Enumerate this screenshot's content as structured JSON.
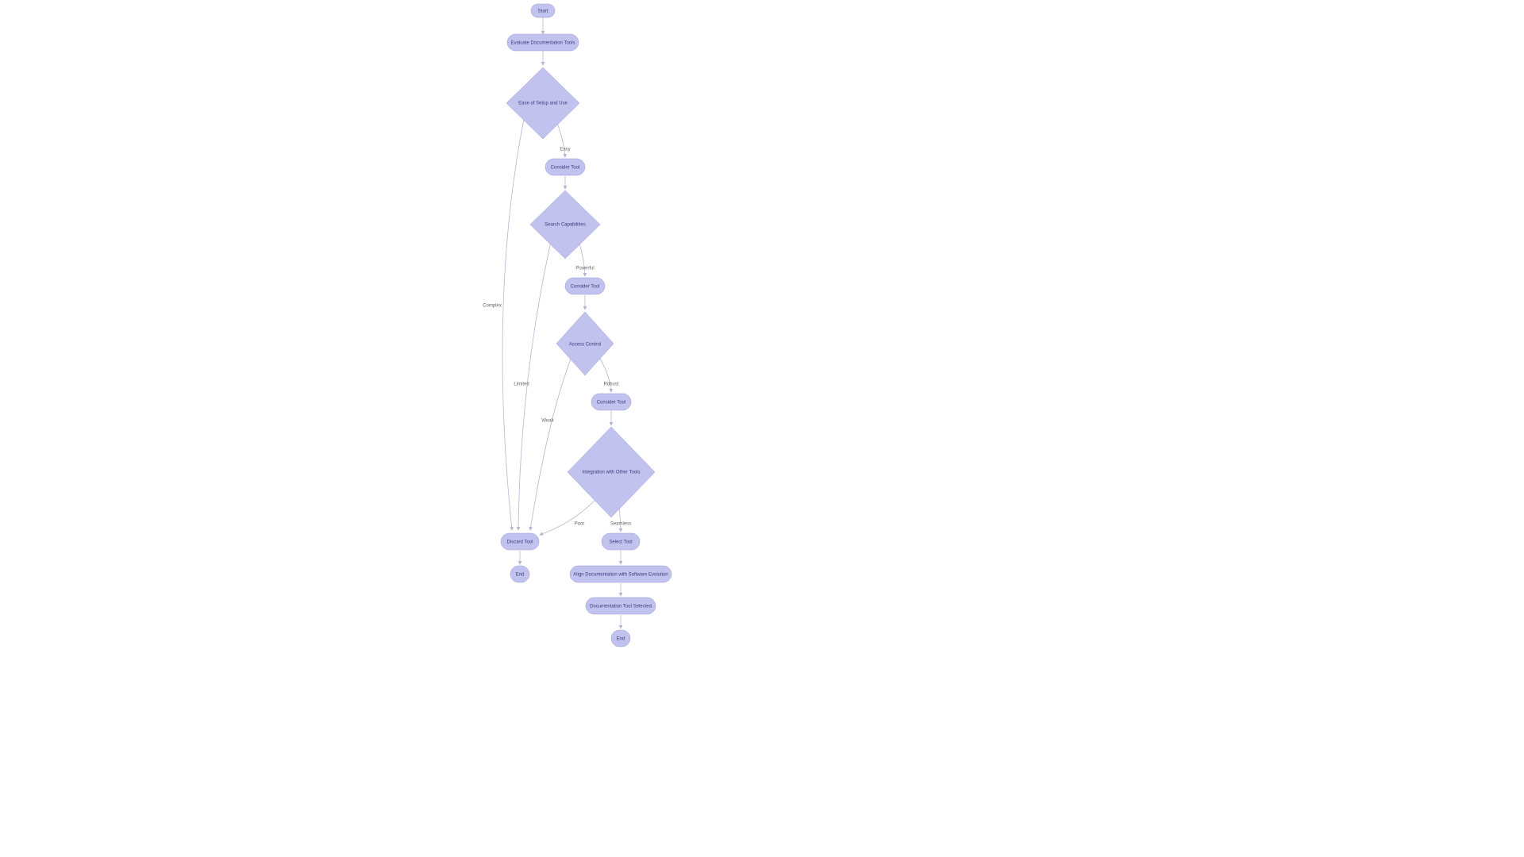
{
  "nodes": {
    "start": "Start",
    "evaluate": "Evaluate Documentation Tools",
    "ease": "Ease of Setup and Use",
    "consider1": "Consider Tool",
    "search": "Search Capabilities",
    "consider2": "Consider Tool",
    "access": "Access Control",
    "consider3": "Consider Tool",
    "integration": "Integration with Other Tools",
    "select": "Select Tool",
    "discard": "Discard Tool",
    "align": "Align Documentation with Software Evolution",
    "selected": "Documentation Tool Selected",
    "end1": "End",
    "end2": "End"
  },
  "edges": {
    "easy": "Easy",
    "complex": "Complex",
    "powerful": "Powerful",
    "limited": "Limited",
    "robust": "Robust",
    "weak": "Weak",
    "seamless": "Seamless",
    "poor": "Poor"
  }
}
